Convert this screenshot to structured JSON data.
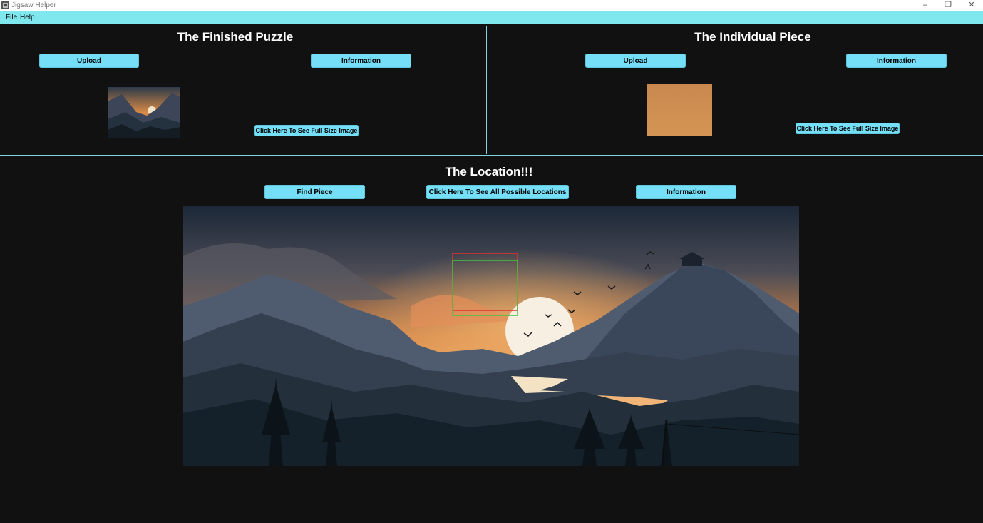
{
  "window": {
    "title": "Jigsaw Helper",
    "controls": [
      "–",
      "❐",
      "✕"
    ]
  },
  "menu": {
    "items": [
      "File",
      "Help"
    ]
  },
  "finished_panel": {
    "title": "The Finished Puzzle",
    "upload_label": "Upload",
    "info_label": "Information",
    "fullsize_label": "Click Here To See Full Size Image"
  },
  "piece_panel": {
    "title": "The Individual Piece",
    "upload_label": "Upload",
    "info_label": "Information",
    "fullsize_label": "Click Here To See Full Size Image"
  },
  "location_panel": {
    "title": "The Location!!!",
    "find_label": "Find Piece",
    "all_locations_label": "Click Here To See All Possible Locations",
    "info_label": "Information"
  },
  "colors": {
    "accent": "#74dff7",
    "background": "#111111",
    "menu_bg": "#7fe7ee",
    "red_box": "#e23030",
    "green_box": "#47c241"
  }
}
